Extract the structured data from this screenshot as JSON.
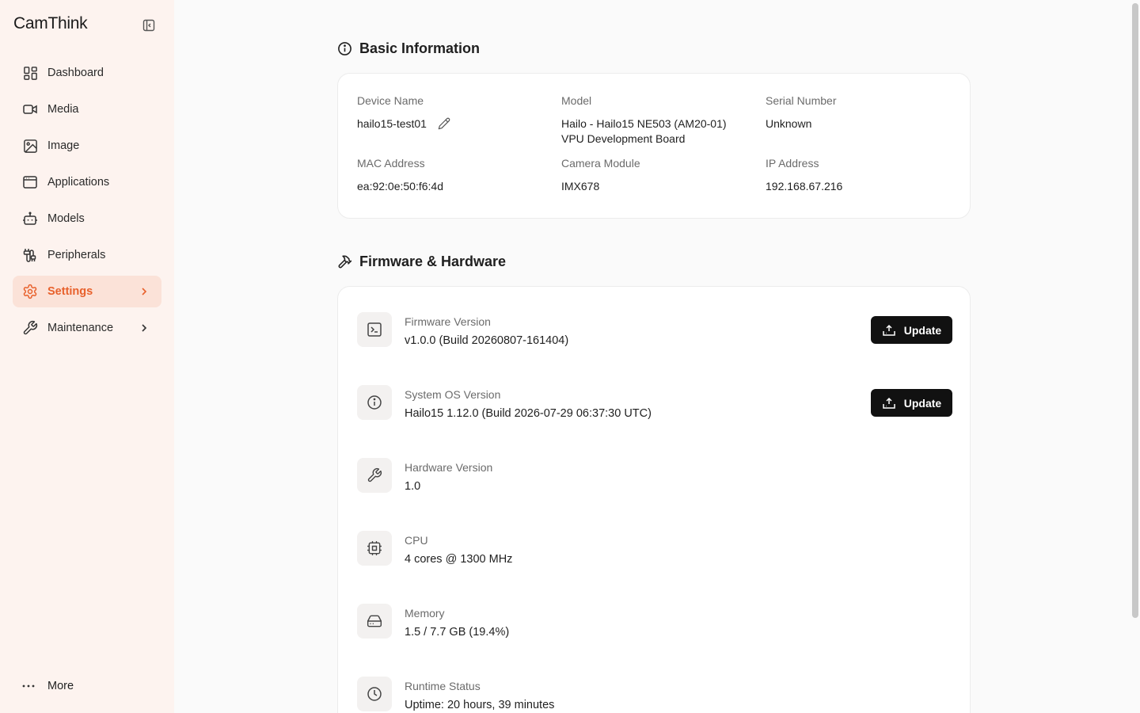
{
  "app": {
    "logo_text": "CamThink",
    "accent_color": "#e8612c"
  },
  "sidebar": {
    "items": [
      {
        "label": "Dashboard",
        "icon": "dashboard-icon"
      },
      {
        "label": "Media",
        "icon": "video-camera-icon"
      },
      {
        "label": "Image",
        "icon": "image-icon"
      },
      {
        "label": "Applications",
        "icon": "app-window-icon"
      },
      {
        "label": "Models",
        "icon": "robot-icon"
      },
      {
        "label": "Peripherals",
        "icon": "cable-icon"
      },
      {
        "label": "Settings",
        "icon": "gear-icon",
        "active": true
      },
      {
        "label": "Maintenance",
        "icon": "wrench-icon"
      }
    ],
    "more_label": "More"
  },
  "basic_info": {
    "title": "Basic Information",
    "device_name_label": "Device Name",
    "device_name_value": "hailo15-test01",
    "model_label": "Model",
    "model_value_line1": "Hailo - Hailo15 NE503 (AM20-01)",
    "model_value_line2": "VPU Development Board",
    "serial_label": "Serial Number",
    "serial_value": "Unknown",
    "mac_label": "MAC Address",
    "mac_value": "ea:92:0e:50:f6:4d",
    "camera_label": "Camera Module",
    "camera_value": "IMX678",
    "ip_label": "IP Address",
    "ip_value": "192.168.67.216"
  },
  "firmware": {
    "title": "Firmware & Hardware",
    "update_label": "Update",
    "rows": [
      {
        "label": "Firmware Version",
        "value": "v1.0.0 (Build 20260807-161404)",
        "icon": "terminal-icon"
      },
      {
        "label": "System OS Version",
        "value": "Hailo15 1.12.0 (Build 2026-07-29 06:37:30 UTC)",
        "icon": "info-icon"
      },
      {
        "label": "Hardware Version",
        "value": "1.0",
        "icon": "wrench-icon"
      },
      {
        "label": "CPU",
        "value": "4 cores @ 1300 MHz",
        "icon": "cpu-icon"
      },
      {
        "label": "Memory",
        "value": "1.5 / 7.7 GB (19.4%)",
        "icon": "hard-drive-icon"
      },
      {
        "label": "Runtime Status",
        "value": "Uptime: 20 hours, 39 minutes",
        "icon": "clock-icon"
      }
    ]
  }
}
